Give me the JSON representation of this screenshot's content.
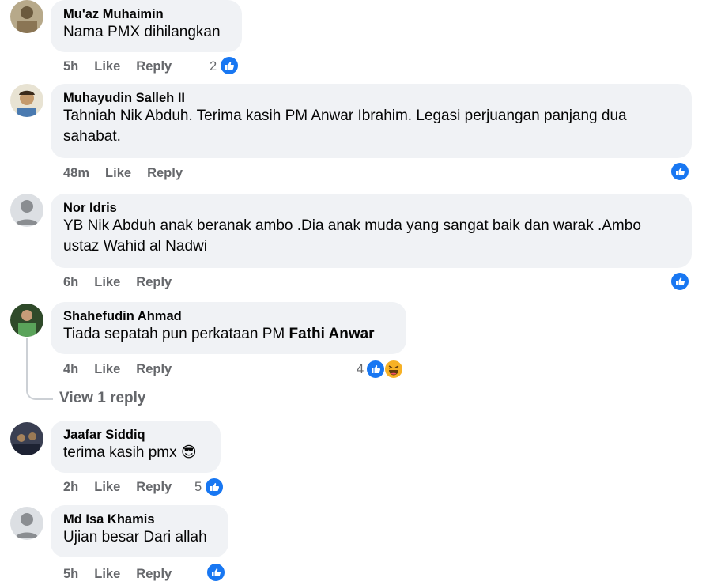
{
  "comments": [
    {
      "name": "Mu'az Muhaimin",
      "text": "Nama PMX dihilangkan",
      "time": "5h",
      "like": "Like",
      "reply": "Reply",
      "count": "2"
    },
    {
      "name": "Muhayudin Salleh II",
      "text": "Tahniah Nik Abduh. Terima kasih PM Anwar Ibrahim. Legasi perjuangan panjang dua sahabat.",
      "time": "48m",
      "like": "Like",
      "reply": "Reply"
    },
    {
      "name": "Nor Idris",
      "text": "YB Nik Abduh anak beranak ambo .Dia anak muda yang sangat baik dan warak .Ambo ustaz Wahid al Nadwi",
      "time": "6h",
      "like": "Like",
      "reply": "Reply"
    },
    {
      "name": "Shahefudin Ahmad",
      "text_plain": "Tiada sepatah pun perkataan PM ",
      "text_bold": "Fathi Anwar",
      "time": "4h",
      "like": "Like",
      "reply": "Reply",
      "count": "4",
      "view_replies": "View 1 reply"
    },
    {
      "name": "Jaafar Siddiq",
      "text": "terima kasih pmx",
      "emoji": "😎",
      "time": "2h",
      "like": "Like",
      "reply": "Reply",
      "count": "5"
    },
    {
      "name": "Md Isa Khamis",
      "text": "Ujian besar Dari allah",
      "time": "5h",
      "like": "Like",
      "reply": "Reply"
    }
  ],
  "icons": {
    "like": "like-reaction-icon",
    "haha": "haha-reaction-icon",
    "cool": "sunglasses-emoji",
    "like_color": "#1877f2"
  }
}
